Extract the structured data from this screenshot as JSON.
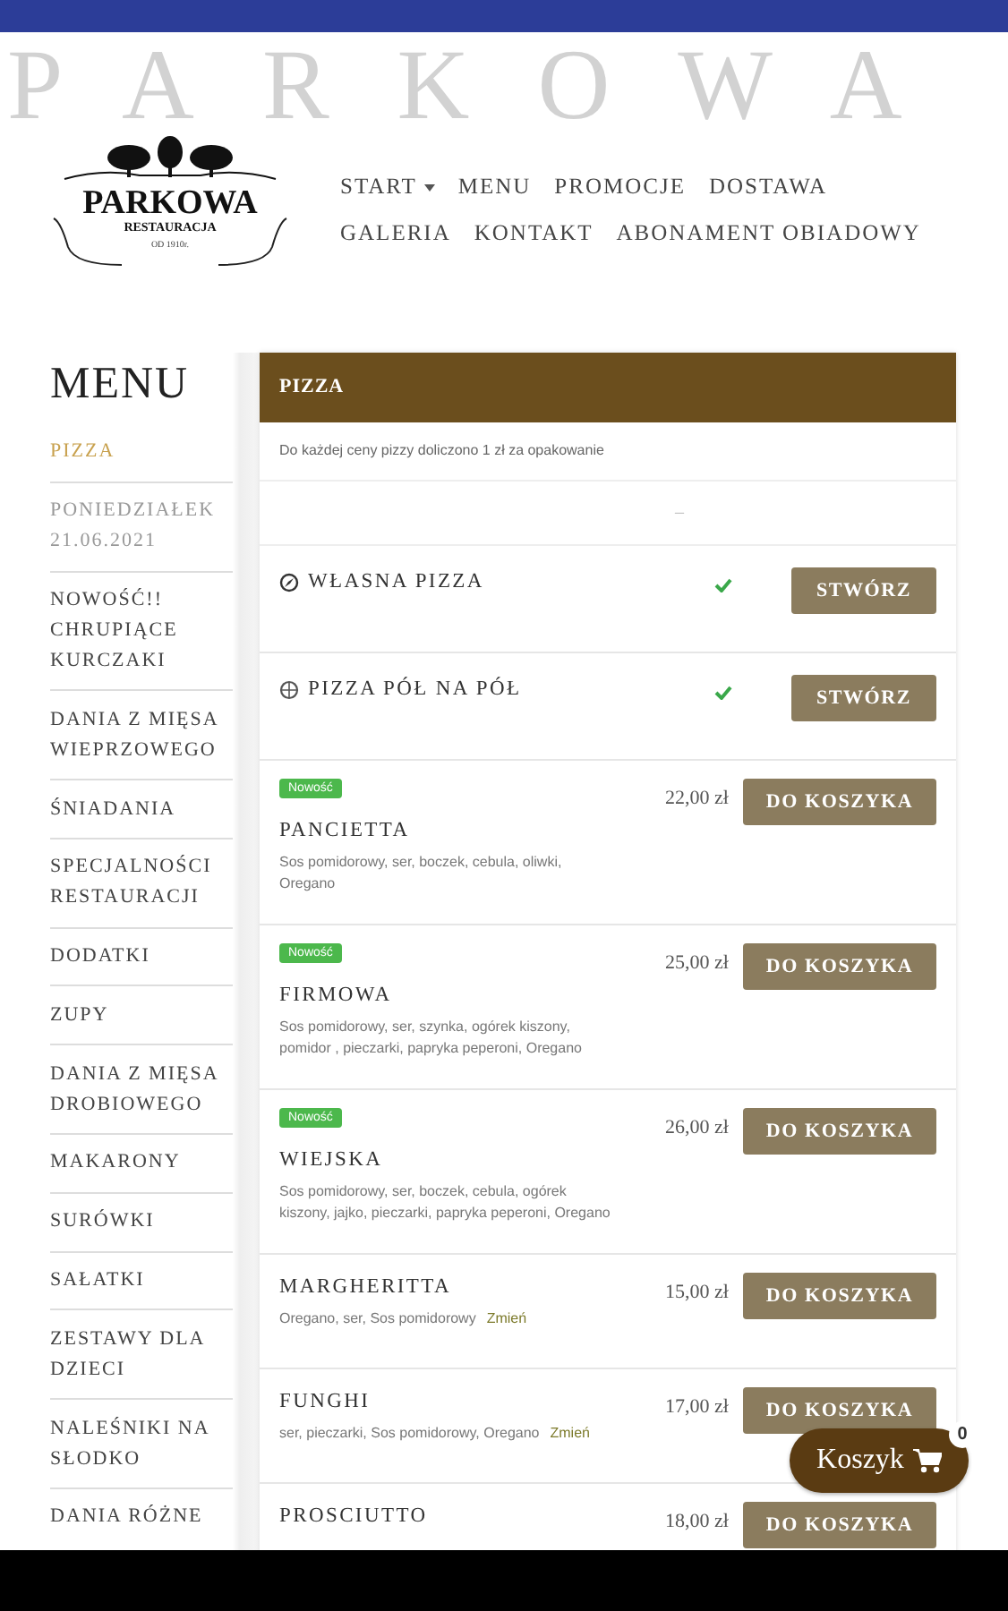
{
  "header": {
    "backdrop_text": "PARKOWA",
    "logo": {
      "name": "PARKOWA",
      "subtitle": "RESTAURACJA",
      "since": "OD 1910r."
    },
    "nav": [
      {
        "label": "START",
        "dropdown": true
      },
      {
        "label": "MENU",
        "dropdown": false
      },
      {
        "label": "PROMOCJE",
        "dropdown": false
      },
      {
        "label": "DOSTAWA",
        "dropdown": false
      },
      {
        "label": "GALERIA",
        "dropdown": false
      },
      {
        "label": "KONTAKT",
        "dropdown": false
      },
      {
        "label": "ABONAMENT OBIADOWY",
        "dropdown": false
      }
    ]
  },
  "sidebar": {
    "title": "MENU",
    "items": [
      {
        "label": "PIZZA",
        "selected": true,
        "disabled": false
      },
      {
        "label": "PONIEDZIAŁEK 21.06.2021",
        "selected": false,
        "disabled": true
      },
      {
        "label": "NOWOŚĆ!! CHRUPIĄCE KURCZAKI",
        "selected": false,
        "disabled": false
      },
      {
        "label": "DANIA Z MIĘSA WIEPRZOWEGO",
        "selected": false,
        "disabled": false
      },
      {
        "label": "ŚNIADANIA",
        "selected": false,
        "disabled": false
      },
      {
        "label": "SPECJALNOŚCI RESTAURACJI",
        "selected": false,
        "disabled": false
      },
      {
        "label": "DODATKI",
        "selected": false,
        "disabled": false
      },
      {
        "label": "ZUPY",
        "selected": false,
        "disabled": false
      },
      {
        "label": "DANIA Z MIĘSA DROBIOWEGO",
        "selected": false,
        "disabled": false
      },
      {
        "label": "MAKARONY",
        "selected": false,
        "disabled": false
      },
      {
        "label": "SURÓWKI",
        "selected": false,
        "disabled": false
      },
      {
        "label": "SAŁATKI",
        "selected": false,
        "disabled": false
      },
      {
        "label": "ZESTAWY DLA DZIECI",
        "selected": false,
        "disabled": false
      },
      {
        "label": "NALEŚNIKI NA SŁODKO",
        "selected": false,
        "disabled": false
      },
      {
        "label": "DANIA RÓŻNE",
        "selected": false,
        "disabled": false
      }
    ]
  },
  "section": {
    "title": "PIZZA",
    "note": "Do każdej ceny pizzy doliczono 1 zł za opakowanie",
    "divider_text": "–",
    "items": [
      {
        "kind": "custom",
        "name": "WŁASNA PIZZA",
        "available": true,
        "button": "STWÓRZ"
      },
      {
        "kind": "halves",
        "name": "PIZZA PÓŁ NA PÓŁ",
        "available": true,
        "button": "STWÓRZ"
      },
      {
        "kind": "product",
        "badge": "Nowość",
        "name": "PANCIETTA",
        "description": "Sos pomidorowy, ser, boczek, cebula, oliwki, Oregano",
        "price": "22,00 zł",
        "button": "DO KOSZYKA"
      },
      {
        "kind": "product",
        "badge": "Nowość",
        "name": "FIRMOWA",
        "description": "Sos pomidorowy, ser, szynka, ogórek kiszony, pomidor , pieczarki, papryka peperoni, Oregano",
        "price": "25,00 zł",
        "button": "DO KOSZYKA"
      },
      {
        "kind": "product",
        "badge": "Nowość",
        "name": "WIEJSKA",
        "description": "Sos pomidorowy, ser, boczek, cebula, ogórek kiszony, jajko, pieczarki, papryka peperoni, Oregano",
        "price": "26,00 zł",
        "button": "DO KOSZYKA"
      },
      {
        "kind": "product",
        "name": "MARGHERITTA",
        "description": "Oregano, ser, Sos pomidorowy",
        "link": "Zmień",
        "price": "15,00 zł",
        "button": "DO KOSZYKA"
      },
      {
        "kind": "product",
        "name": "FUNGHI",
        "description": "ser, pieczarki, Sos pomidorowy, Oregano",
        "link": "Zmień",
        "price": "17,00 zł",
        "button": "DO KOSZYKA"
      },
      {
        "kind": "product",
        "name": "PROSCIUTTO",
        "price": "18,00 zł",
        "button": "DO KOSZYKA"
      }
    ]
  },
  "cart": {
    "label": "Koszyk",
    "count": "0"
  }
}
